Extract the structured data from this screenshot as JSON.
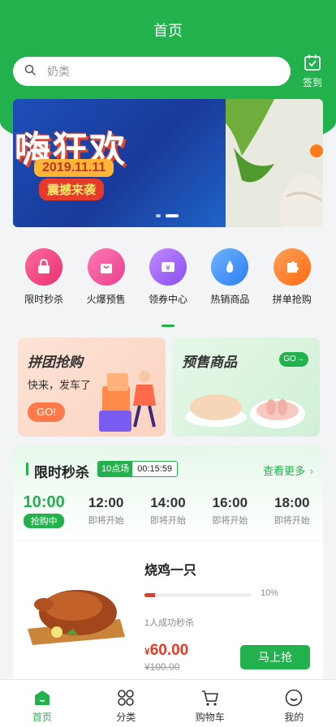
{
  "header": {
    "title": "首页"
  },
  "search": {
    "placeholder": "奶类"
  },
  "signin": {
    "label": "签到"
  },
  "banner": {
    "headline": "嗨狂欢",
    "date": "2019.11.11",
    "subtitle": "震撼来袭"
  },
  "categories": [
    {
      "label": "限时秒杀",
      "icon": "lock-bag-icon",
      "color": "#f5458e"
    },
    {
      "label": "火爆预售",
      "icon": "shopping-bag-icon",
      "color": "#f25ba0"
    },
    {
      "label": "领券中心",
      "icon": "coupon-icon",
      "color": "#a263f5"
    },
    {
      "label": "热销商品",
      "icon": "flame-icon",
      "color": "#3a8ff5"
    },
    {
      "label": "拼单抢购",
      "icon": "puzzle-icon",
      "color": "#ff7a1a"
    }
  ],
  "promos": {
    "group": {
      "title": "拼团抢购",
      "desc": "快来，发车了",
      "button": "GO!"
    },
    "presale": {
      "title": "预售商品",
      "button": "GO→"
    }
  },
  "flash_sale": {
    "title": "限时秒杀",
    "session": "10点场",
    "countdown": "00:15:59",
    "more": "查看更多",
    "slots": [
      {
        "time": "10:00",
        "status": "抢购中",
        "active": true
      },
      {
        "time": "12:00",
        "status": "即将开始",
        "active": false
      },
      {
        "time": "14:00",
        "status": "即将开始",
        "active": false
      },
      {
        "time": "16:00",
        "status": "即将开始",
        "active": false
      },
      {
        "time": "18:00",
        "status": "即将开始",
        "active": false
      }
    ]
  },
  "product": {
    "name": "烧鸡一只",
    "progress": 0.1,
    "progress_label": "10%",
    "sold": "1人成功秒杀",
    "currency": "¥",
    "price": "60.00",
    "original_price": "¥100.00",
    "buy_label": "马上抢"
  },
  "tabbar": [
    {
      "label": "首页",
      "icon": "home-icon",
      "active": true
    },
    {
      "label": "分类",
      "icon": "category-icon",
      "active": false
    },
    {
      "label": "购物车",
      "icon": "cart-icon",
      "active": false
    },
    {
      "label": "我的",
      "icon": "profile-icon",
      "active": false
    }
  ],
  "colors": {
    "brand": "#22b14c",
    "price": "#e63a2a"
  }
}
